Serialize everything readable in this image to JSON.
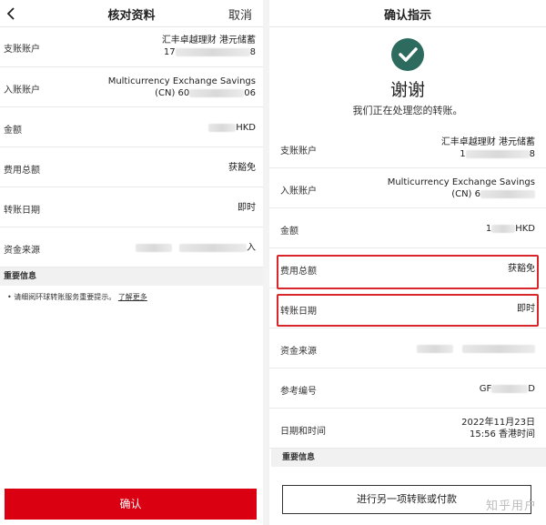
{
  "left": {
    "title": "核对资料",
    "cancel_label": "取消",
    "rows": [
      {
        "label": "支账账户",
        "value_line1": "汇丰卓越理财 港元储蓄",
        "value_line2_prefix": "17",
        "value_line2_suffix": "8"
      },
      {
        "label": "入账账户",
        "value_line1": "Multicurrency Exchange Savings",
        "value_line2_prefix": "(CN) 60",
        "value_line2_suffix": "06"
      },
      {
        "label": "金额",
        "value_suffix": "HKD"
      },
      {
        "label": "费用总额",
        "value": "获豁免"
      },
      {
        "label": "转账日期",
        "value": "即时"
      },
      {
        "label": "资金来源",
        "value_suffix": "入"
      }
    ],
    "important_header": "重要信息",
    "notice_text": "请细阅环球转账服务重要提示。",
    "notice_link": "了解更多",
    "confirm_label": "确认"
  },
  "right": {
    "title": "确认指示",
    "thanks": "谢谢",
    "processing": "我们正在处理您的转账。",
    "rows": [
      {
        "label": "支账账户",
        "value_line1": "汇丰卓越理财 港元储蓄",
        "value_line2_prefix": "1",
        "value_line2_suffix": "8"
      },
      {
        "label": "入账账户",
        "value_line1": "Multicurrency Exchange Savings",
        "value_line2_prefix": "(CN) 6",
        "value_line2_suffix": ""
      },
      {
        "label": "金额",
        "value_prefix": "1",
        "value_suffix": "HKD"
      },
      {
        "label": "费用总额",
        "value": "获豁免"
      },
      {
        "label": "转账日期",
        "value": "即时"
      },
      {
        "label": "资金来源"
      },
      {
        "label": "参考编号",
        "value_prefix": "GF",
        "value_suffix": "D"
      },
      {
        "label": "日期和时间",
        "value_line1": "2022年11月23日",
        "value_line2": "15:56 香港时间"
      }
    ],
    "important_header": "重要信息",
    "another_label": "进行另一项转账或付款"
  },
  "watermark": "知乎用户"
}
